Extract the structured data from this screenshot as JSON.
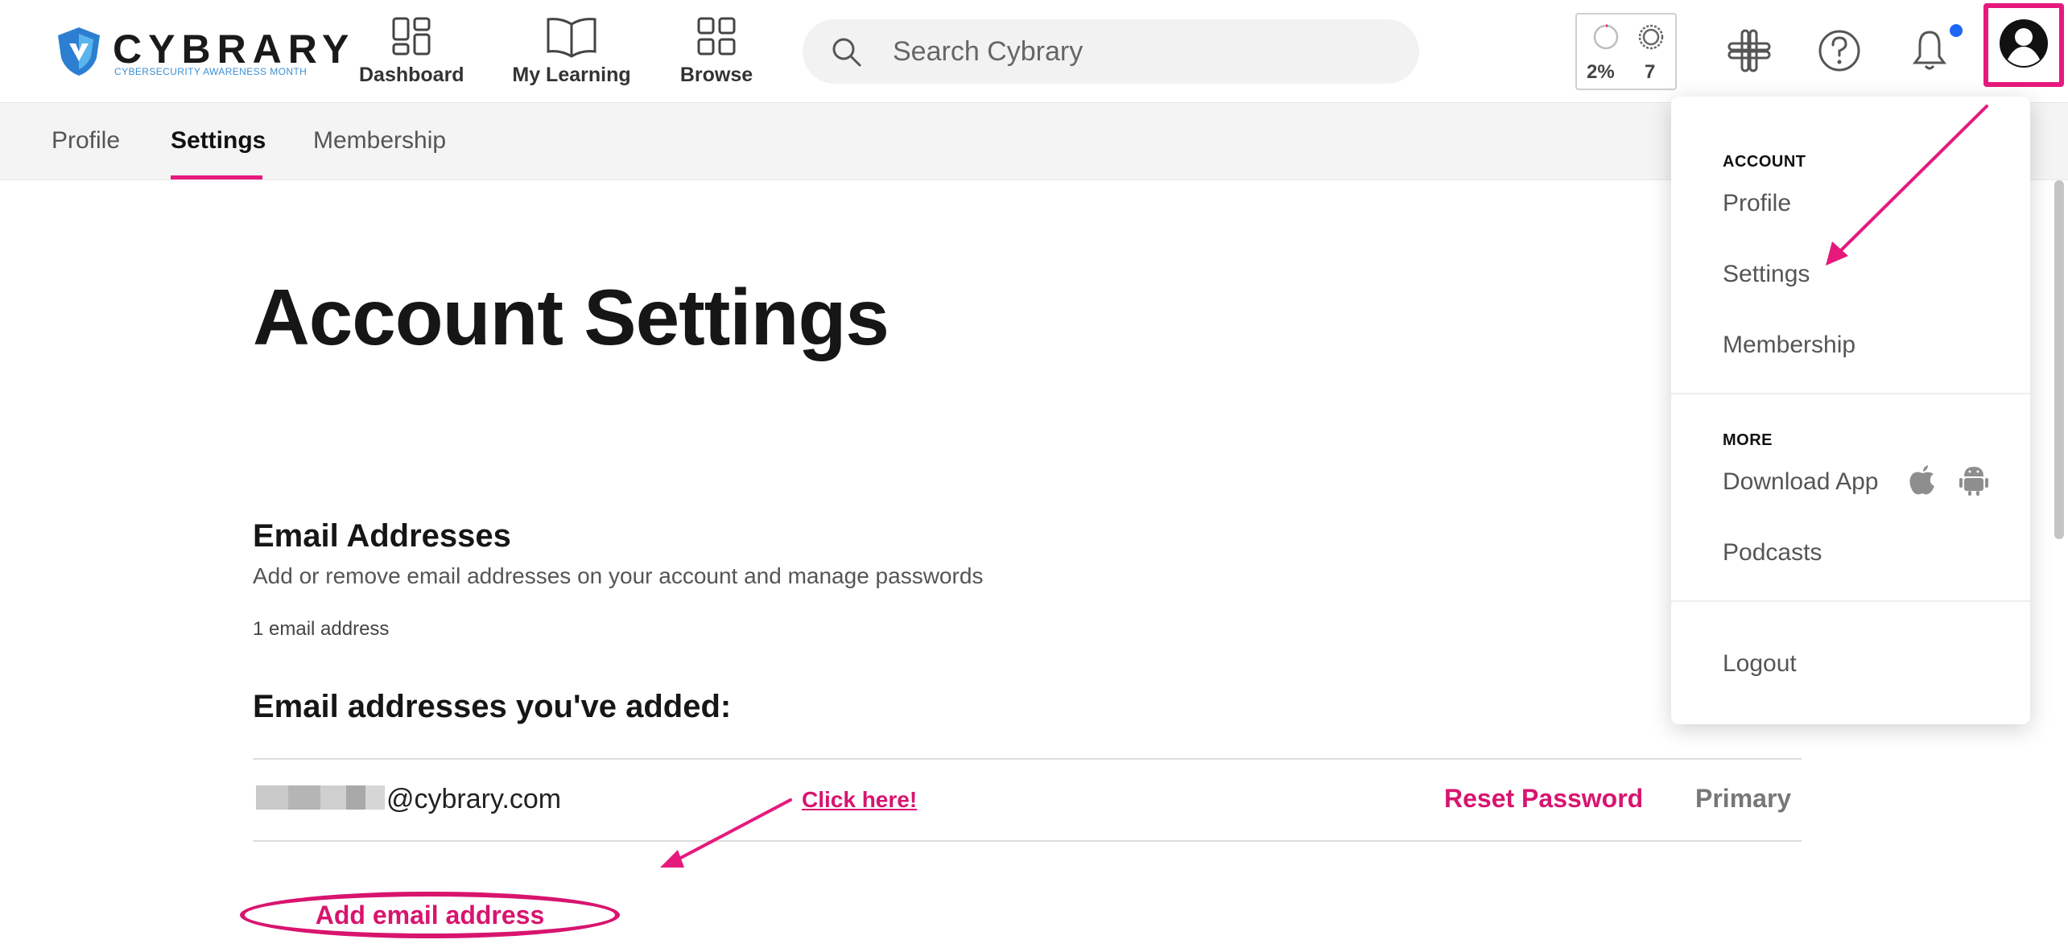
{
  "header": {
    "logo_name": "CYBRARY",
    "logo_tagline": "CYBERSECURITY AWARENESS MONTH",
    "nav": [
      {
        "label": "Dashboard",
        "icon": "dashboard-icon"
      },
      {
        "label": "My Learning",
        "icon": "book-icon"
      },
      {
        "label": "Browse",
        "icon": "grid-icon"
      }
    ],
    "search": {
      "placeholder": "Search Cybrary"
    },
    "progress": {
      "percent": "2%",
      "count": "7",
      "percent_value": 0.02
    },
    "icons": [
      "slack-icon",
      "help-icon",
      "bell-icon",
      "avatar-icon"
    ],
    "accent_color": "#e6197d"
  },
  "subnav": {
    "tabs": [
      {
        "label": "Profile",
        "active": false
      },
      {
        "label": "Settings",
        "active": true
      },
      {
        "label": "Membership",
        "active": false
      }
    ]
  },
  "main": {
    "title": "Account Settings",
    "email_section": {
      "title": "Email Addresses",
      "description": "Add or remove email addresses on your account and manage passwords",
      "count": "1 email address",
      "added_title": "Email addresses you've added:",
      "emails": [
        {
          "domain": "@cybrary.com",
          "reset_label": "Reset Password",
          "status": "Primary"
        }
      ],
      "add_label": "Add email address"
    },
    "annotation": "Click here!"
  },
  "dropdown": {
    "account_header": "ACCOUNT",
    "account_items": [
      "Profile",
      "Settings",
      "Membership"
    ],
    "more_header": "MORE",
    "more_items": [
      "Download App",
      "Podcasts"
    ],
    "logout": "Logout"
  }
}
